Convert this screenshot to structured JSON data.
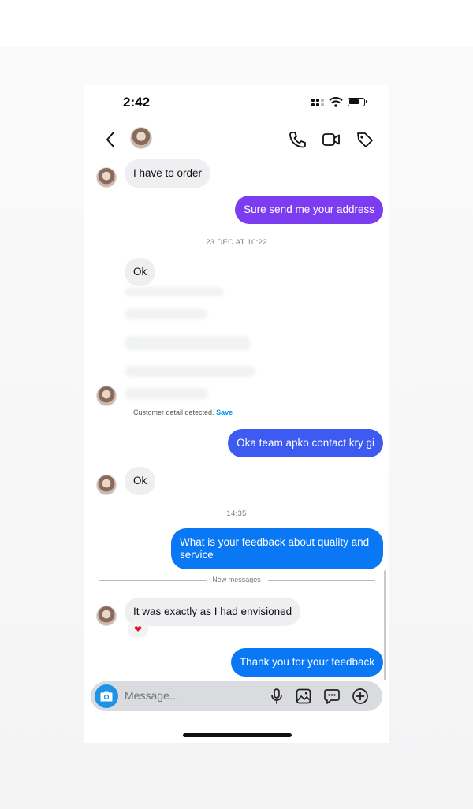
{
  "status": {
    "time": "2:42"
  },
  "messages": [
    {
      "side": "in",
      "text": "I have to order"
    },
    {
      "side": "out",
      "text": "Sure send me your address"
    },
    {
      "side": "ts",
      "text": "23 DEC AT 10:22"
    },
    {
      "side": "in",
      "text": "Ok"
    },
    {
      "side": "out",
      "text": "Oka team apko contact kry gi"
    },
    {
      "side": "in",
      "text": "Ok"
    },
    {
      "side": "ts",
      "text": "14:35"
    },
    {
      "side": "out",
      "text": "What is your feedback about quality and service"
    },
    {
      "side": "in",
      "text": "It was exactly as I had envisioned"
    },
    {
      "side": "out",
      "text": "Thank you for your feedback"
    }
  ],
  "detected": {
    "text": "Customer detail detected.",
    "save_label": "Save"
  },
  "new_messages_label": "New messages",
  "reaction": "❤",
  "composer": {
    "placeholder": "Message..."
  },
  "colors": {
    "bubble_purple": "#7c3cf0",
    "bubble_indigo": "#3d5af1",
    "bubble_blue": "#0a78f5",
    "incoming_bubble": "#efeff1",
    "link_blue": "#0095f6"
  },
  "icons": [
    "back-arrow-icon",
    "phone-icon",
    "video-icon",
    "tag-icon",
    "camera-icon",
    "microphone-icon",
    "gallery-icon",
    "sticker-icon",
    "plus-circle-icon"
  ]
}
